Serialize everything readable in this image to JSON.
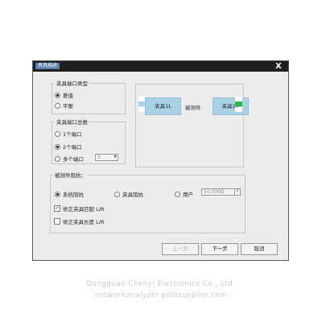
{
  "dialog": {
    "title": "夹具描述",
    "close_glyph": "X"
  },
  "fixture_type": {
    "legend": "夹具端口类型",
    "options": [
      {
        "label": "差值",
        "selected": true
      },
      {
        "label": "平衡",
        "selected": false
      }
    ]
  },
  "port_count": {
    "legend": "夹具端口总数",
    "options": [
      {
        "label": "1个端口",
        "selected": false
      },
      {
        "label": "2个端口",
        "selected": true
      },
      {
        "label": "多个端口",
        "selected": false
      }
    ],
    "multi_value": "3"
  },
  "diagram": {
    "left_fixture": "夹具1L",
    "dut": "被测件",
    "right_fixture": "夹具1R",
    "port_colors": [
      "#ffffff",
      "#2eb84a"
    ]
  },
  "impedance": {
    "legend": "被测件阻抗：",
    "options": [
      {
        "label": "系统阻抗",
        "selected": true
      },
      {
        "label": "夹具阻抗",
        "selected": false
      },
      {
        "label": "用户",
        "selected": false
      }
    ],
    "user_value": "50.000Ω",
    "checks": [
      {
        "label": "修正夹具匹配 L/R",
        "checked": true
      },
      {
        "label": "修正夹具长度 L/R",
        "checked": false
      }
    ]
  },
  "buttons": {
    "prev": "上一步",
    "next": "下一步",
    "cancel": "取消"
  },
  "watermark": {
    "line1": "Dongguan Chenyi Electronics Co., Ltd.",
    "line2": "networkanalyzer.goldsupplier.com"
  }
}
